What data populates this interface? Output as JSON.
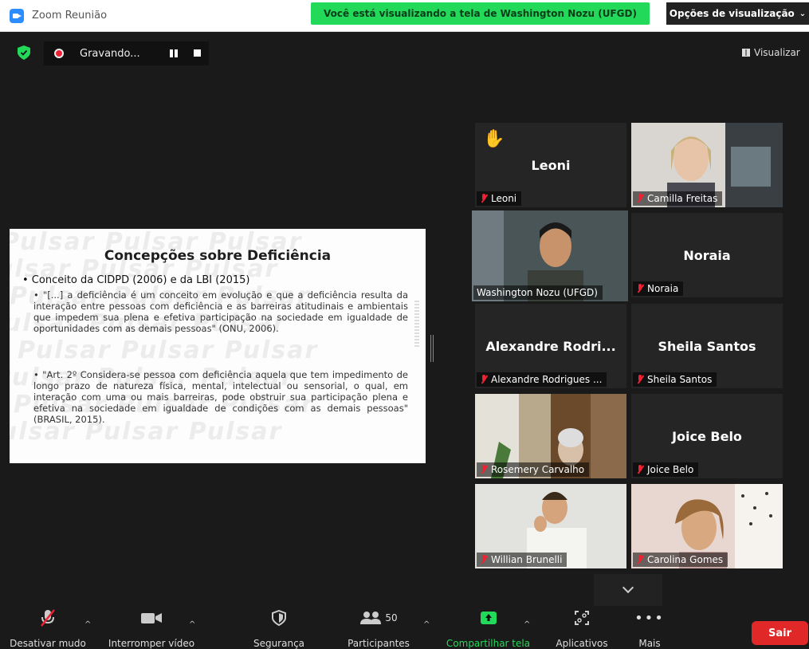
{
  "titlebar": {
    "app_title": "Zoom Reunião",
    "share_banner": "Você está visualizando a tela de Washington Nozu (UFGD)",
    "view_options": "Opções de visualização"
  },
  "recording": {
    "label": "Gravando..."
  },
  "view_button": "Visualizar",
  "slide": {
    "title": "Concepções sobre Deficiência",
    "bullet": "• Conceito da CIDPD (2006) e da LBI (2015)",
    "quote1": "• \"[...] a deficiência é um conceito em evolução e que a deficiência resulta da interação entre pessoas com deficiência e as barreiras atitudinais e ambientais que impedem sua plena e efetiva participação na sociedade em igualdade de oportunidades com as demais pessoas\" (ONU, 2006).",
    "quote2": "• \"Art. 2º Considera-se pessoa com deficiência aquela que tem impedimento de longo prazo de natureza física, mental, intelectual ou sensorial, o qual, em interação com uma ou mais barreiras, pode obstruir sua participação plena e efetiva na sociedade em igualdade de condições com as demais pessoas\" (BRASIL, 2015).",
    "watermark": "Pulsar Pulsar Pulsar"
  },
  "participants": [
    {
      "name": "Leoni",
      "label": "Leoni",
      "video": false,
      "hand": true
    },
    {
      "name": "",
      "label": "Camilla Freitas",
      "video": true
    },
    {
      "name": "",
      "label": "Washington Nozu (UFGD)",
      "video": true,
      "speaking": true
    },
    {
      "name": "Noraia",
      "label": "Noraia",
      "video": false
    },
    {
      "name": "Alexandre  Rodri...",
      "label": "Alexandre Rodrigues ...",
      "video": false
    },
    {
      "name": "Sheila Santos",
      "label": "Sheila Santos",
      "video": false
    },
    {
      "name": "",
      "label": "Rosemery Carvalho",
      "video": true
    },
    {
      "name": "Joice Belo",
      "label": "Joice Belo",
      "video": false
    },
    {
      "name": "",
      "label": "Willian Brunelli",
      "video": true
    },
    {
      "name": "",
      "label": "Carolina Gomes",
      "video": true
    }
  ],
  "toolbar": {
    "mute": "Desativar mudo",
    "video": "Interromper vídeo",
    "security": "Segurança",
    "participants": "Participantes",
    "participants_count": "50",
    "share": "Compartilhar tela",
    "apps": "Aplicativos",
    "more": "Mais",
    "leave": "Sair"
  }
}
